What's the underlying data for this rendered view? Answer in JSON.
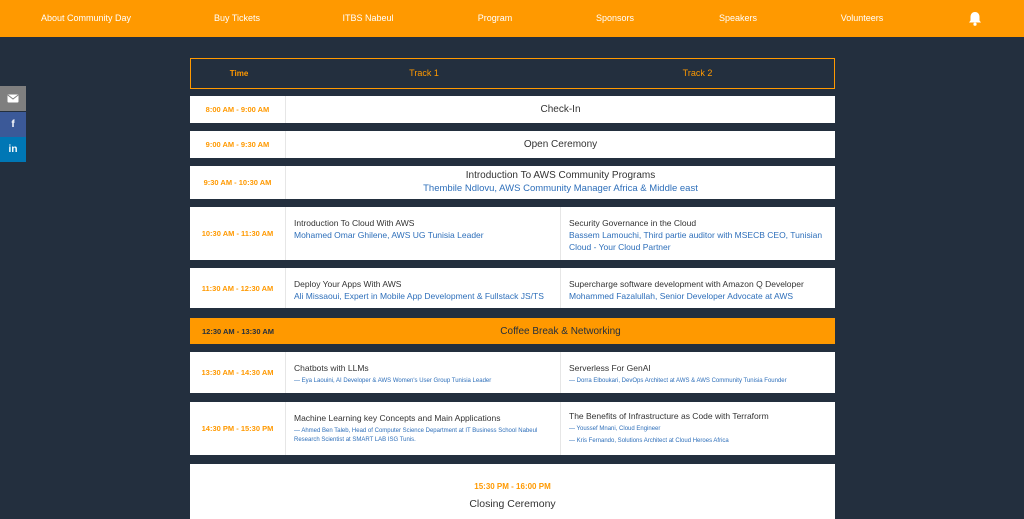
{
  "nav": {
    "items": [
      "About Community Day",
      "Buy Tickets",
      "ITBS Nabeul",
      "Program",
      "Sponsors",
      "Speakers",
      "Volunteers"
    ],
    "bell_icon": "bell-icon"
  },
  "share": {
    "email_icon": "email-icon",
    "facebook_label": "f",
    "linkedin_label": "in"
  },
  "colors": {
    "accent": "#ff9900",
    "background": "#232f3e",
    "speaker": "#2e6fba"
  },
  "schedule": {
    "header": {
      "time": "Time",
      "track1": "Track 1",
      "track2": "Track 2"
    },
    "rows": [
      {
        "time": "8:00 AM - 9:00 AM",
        "title": "Check-In"
      },
      {
        "time": "9:00 AM - 9:30 AM",
        "title": "Open Ceremony"
      },
      {
        "time": "9:30 AM - 10:30 AM",
        "title": "Introduction To AWS Community Programs",
        "speaker": "Thembile Ndlovu, AWS Community Manager Africa & Middle east"
      },
      {
        "time": "10:30 AM - 11:30 AM",
        "left": {
          "title": "Introduction To Cloud With AWS",
          "speaker": "Mohamed Omar Ghilene, AWS UG Tunisia Leader"
        },
        "right": {
          "title": "Security Governance in the Cloud",
          "speaker": "Bassem Lamouchi, Third partie auditor with MSECB CEO, Tunisian Cloud - Your Cloud Partner"
        }
      },
      {
        "time": "11:30 AM - 12:30 AM",
        "left": {
          "title": "Deploy Your Apps With AWS",
          "speaker": "Ali Missaoui, Expert in Mobile App Development & Fullstack JS/TS"
        },
        "right": {
          "title": "Supercharge software development with Amazon Q Developer",
          "speaker": "Mohammed Fazalullah, Senior Developer Advocate at AWS"
        }
      },
      {
        "time": "12:30 AM - 13:30 AM",
        "title": "Coffee Break & Networking"
      },
      {
        "time": "13:30 AM - 14:30 AM",
        "left": {
          "title": "Chatbots with LLMs",
          "speakers": [
            "— Eya Laouini, AI Developer & AWS Women's User Group Tunisia Leader"
          ]
        },
        "right": {
          "title": "Serverless For GenAI",
          "speakers": [
            "— Dorra Elboukari, DevOps Architect at AWS & AWS Community Tunisia Founder"
          ]
        }
      },
      {
        "time": "14:30 PM - 15:30 PM",
        "left": {
          "title": "Machine Learning key Concepts and Main Applications",
          "speakers": [
            "— Ahmed Ben Taleb, Head of Computer Science Department at IT Business School Nabeul Research Scientist at SMART LAB ISG Tunis."
          ]
        },
        "right": {
          "title": "The Benefits of Infrastructure as Code with Terraform",
          "speakers": [
            "— Youssef Mnani, Cloud Engineer",
            "— Kris Fernando, Solutions Architect at Cloud Heroes Africa"
          ]
        }
      },
      {
        "time": "15:30 PM - 16:00 PM",
        "title": "Closing Ceremony"
      }
    ]
  }
}
